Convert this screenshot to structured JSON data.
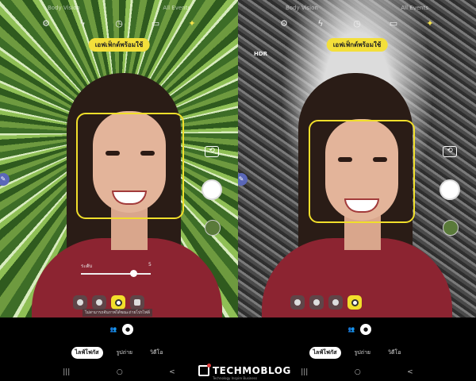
{
  "left_phone": {
    "top_labels": [
      "Body Vision",
      "All Events"
    ],
    "icons": [
      "settings-icon",
      "flash-off-icon",
      "timer-icon",
      "aspect-ratio-icon",
      "effects-icon"
    ],
    "effect_label": "เอฟเฟ็กต์พร้อมใช้",
    "slider": {
      "label": "ระดับ",
      "value_label": "5",
      "value": 0.75
    },
    "effect_hint": "ไม่สามารถจับภาพได้ขณะถ่ายโปรไฟล์",
    "modes": [
      "ไลฟ์โฟกัส",
      "รูปถ่าย",
      "วิดีโอ"
    ],
    "active_mode": "ไลฟ์โฟกัส",
    "nav": [
      "|||",
      "○",
      "<"
    ]
  },
  "right_phone": {
    "top_labels": [
      "Body Vision",
      "All Events"
    ],
    "icons": [
      "settings-icon",
      "flash-off-icon",
      "timer-icon",
      "aspect-ratio-icon",
      "effects-icon"
    ],
    "effect_label": "เอฟเฟ็กต์พร้อมใช้",
    "hdr_label": "HDR",
    "modes": [
      "ไลฟ์โฟกัส",
      "รูปถ่าย",
      "วิดีโอ"
    ],
    "active_mode": "ไลฟ์โฟกัส",
    "nav": [
      "|||",
      "○",
      "<"
    ]
  },
  "brand": {
    "name": "TECHMOBLOG",
    "tagline": "Technology Inspire Business"
  },
  "colors": {
    "accent": "#f1df2b",
    "shirt": "#8c2431"
  }
}
